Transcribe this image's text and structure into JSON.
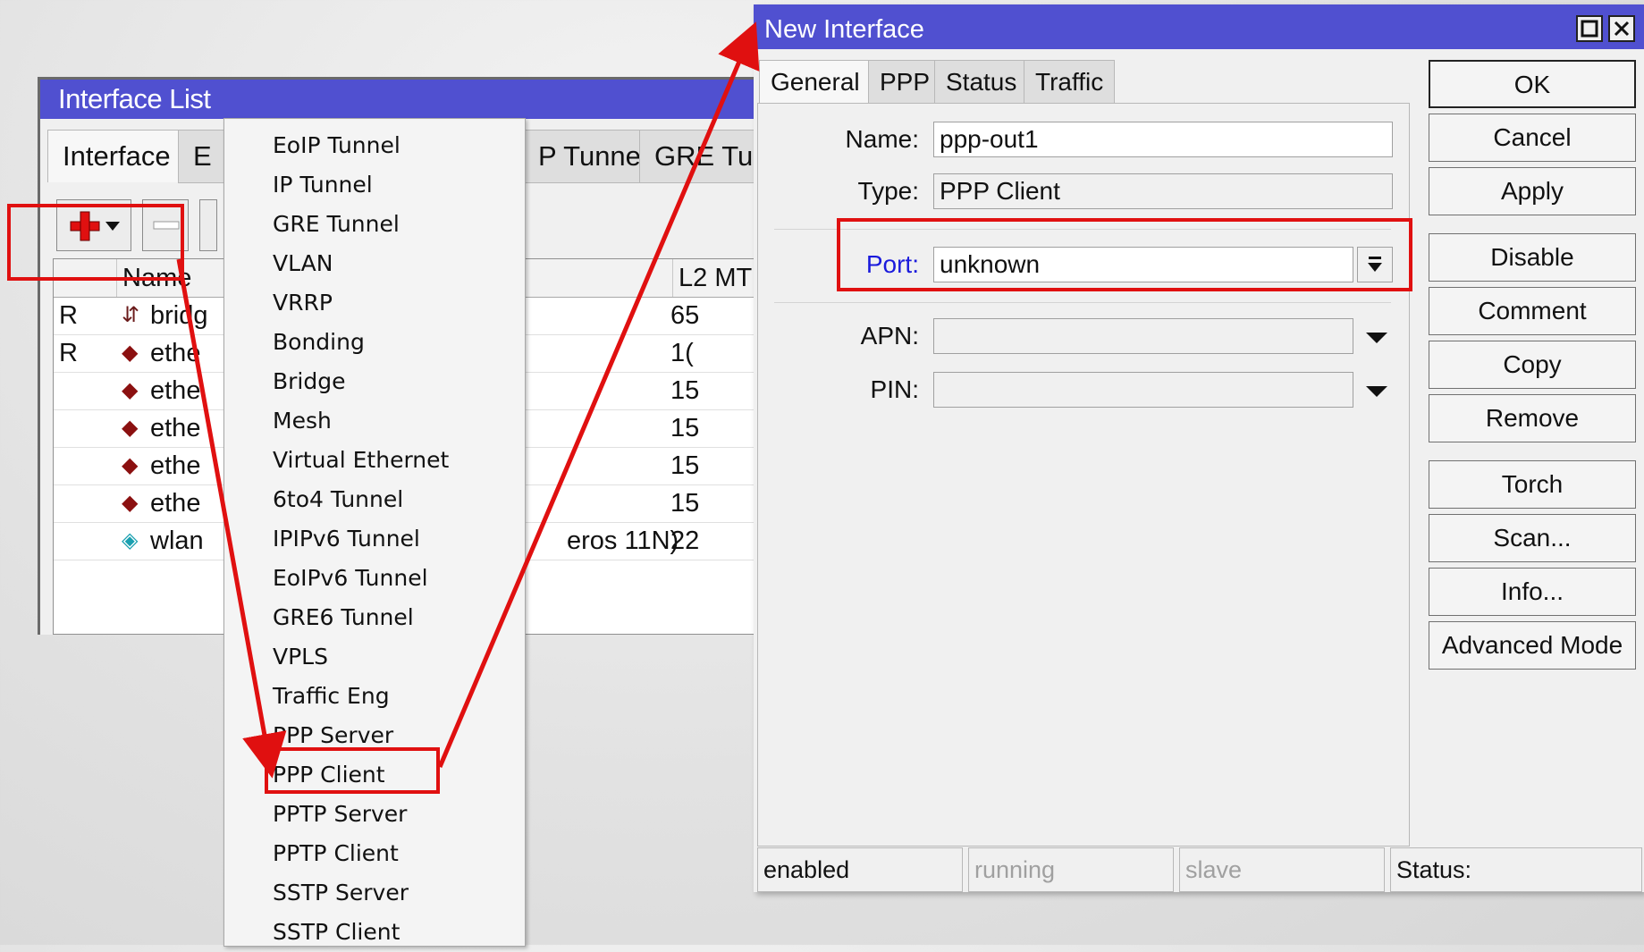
{
  "interface_list": {
    "title": "Interface List",
    "tabs": [
      "Interface",
      "E",
      "P Tunnel",
      "GRE Tu"
    ],
    "columns": [
      "Name",
      "L2 MT"
    ],
    "rows": [
      {
        "flag": "R",
        "name": "bridg",
        "type": "",
        "mtu": "65"
      },
      {
        "flag": "R",
        "name": "ethe",
        "type": "",
        "mtu": "1("
      },
      {
        "flag": "",
        "name": "ethe",
        "type": "",
        "mtu": "15"
      },
      {
        "flag": "",
        "name": "ethe",
        "type": "",
        "mtu": "15"
      },
      {
        "flag": "",
        "name": "ethe",
        "type": "",
        "mtu": "15"
      },
      {
        "flag": "",
        "name": "ethe",
        "type": "",
        "mtu": "15"
      },
      {
        "flag": "",
        "name": "wlan",
        "type": "eros 11N)",
        "mtu": "22"
      }
    ]
  },
  "add_menu": {
    "items": [
      "EoIP Tunnel",
      "IP Tunnel",
      "GRE Tunnel",
      "VLAN",
      "VRRP",
      "Bonding",
      "Bridge",
      "Mesh",
      "Virtual Ethernet",
      "6to4 Tunnel",
      "IPIPv6 Tunnel",
      "EoIPv6 Tunnel",
      "GRE6 Tunnel",
      "VPLS",
      "Traffic Eng",
      "PPP Server",
      "PPP Client",
      "PPTP Server",
      "PPTP Client",
      "SSTP Server",
      "SSTP Client"
    ]
  },
  "dialog": {
    "title": "New Interface",
    "tabs": [
      "General",
      "PPP",
      "Status",
      "Traffic"
    ],
    "fields": {
      "name_label": "Name:",
      "name_value": "ppp-out1",
      "type_label": "Type:",
      "type_value": "PPP Client",
      "port_label": "Port:",
      "port_value": "unknown",
      "apn_label": "APN:",
      "apn_value": "",
      "pin_label": "PIN:",
      "pin_value": ""
    },
    "buttons": [
      "OK",
      "Cancel",
      "Apply",
      "Disable",
      "Comment",
      "Copy",
      "Remove",
      "Torch",
      "Scan...",
      "Info...",
      "Advanced Mode"
    ],
    "status_bar": {
      "enabled": "enabled",
      "running": "running",
      "slave": "slave",
      "status": "Status:"
    }
  },
  "colors": {
    "titlebar": "#5050d0",
    "highlight": "#e01010",
    "port_label": "#1a1adc"
  }
}
